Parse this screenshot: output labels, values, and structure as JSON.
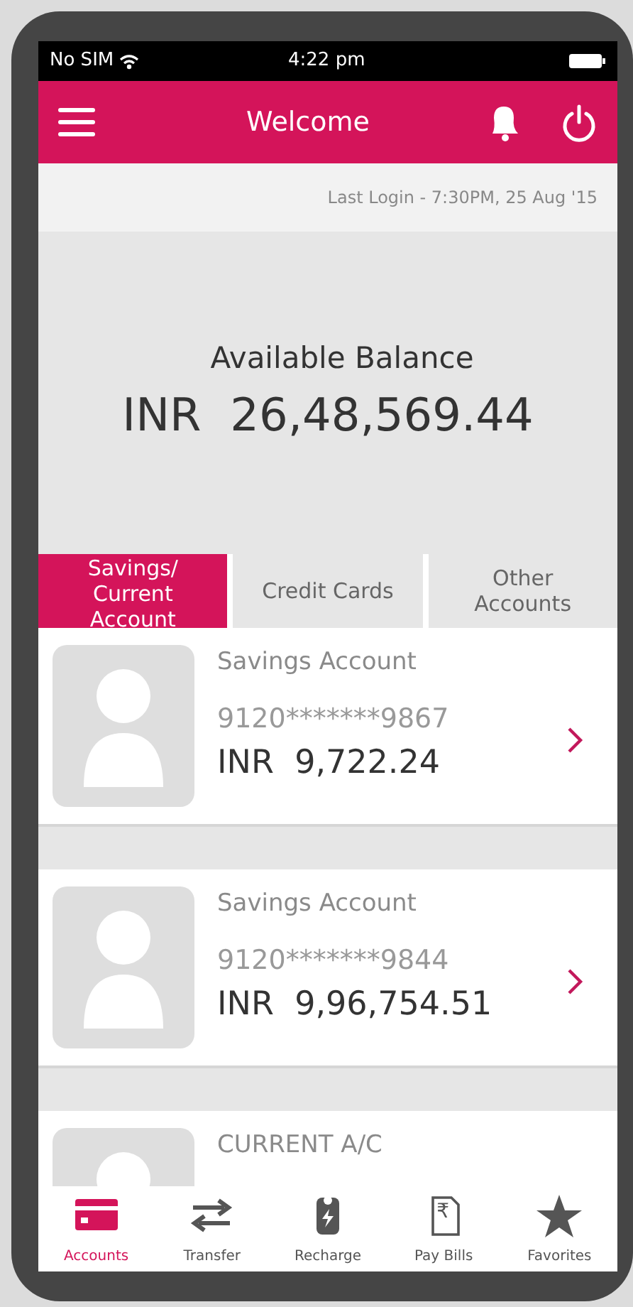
{
  "status_bar": {
    "carrier": "No SIM",
    "time": "4:22 pm"
  },
  "header": {
    "title": "Welcome"
  },
  "last_login": "Last Login - 7:30PM, 25 Aug '15",
  "balance": {
    "label": "Available Balance",
    "amount": "INR  26,48,569.44"
  },
  "tabs": [
    {
      "label": "Savings/\nCurrent Account",
      "selected": true
    },
    {
      "label": "Credit Cards",
      "selected": false
    },
    {
      "label": "Other\nAccounts",
      "selected": false
    }
  ],
  "accounts": [
    {
      "type": "Savings Account",
      "number": "9120*******9867",
      "balance": "INR  9,722.24"
    },
    {
      "type": "Savings Account",
      "number": "9120*******9844",
      "balance": "INR  9,96,754.51"
    },
    {
      "type": "CURRENT A/C"
    }
  ],
  "bottom_nav": [
    {
      "kind": "card",
      "label": "Accounts",
      "selected": true
    },
    {
      "kind": "transfer",
      "label": "Transfer",
      "selected": false
    },
    {
      "kind": "battery",
      "label": "Recharge",
      "selected": false
    },
    {
      "kind": "bill",
      "label": "Pay Bills",
      "glyph": "₹",
      "selected": false
    },
    {
      "kind": "star",
      "label": "Favorites",
      "selected": false
    }
  ]
}
